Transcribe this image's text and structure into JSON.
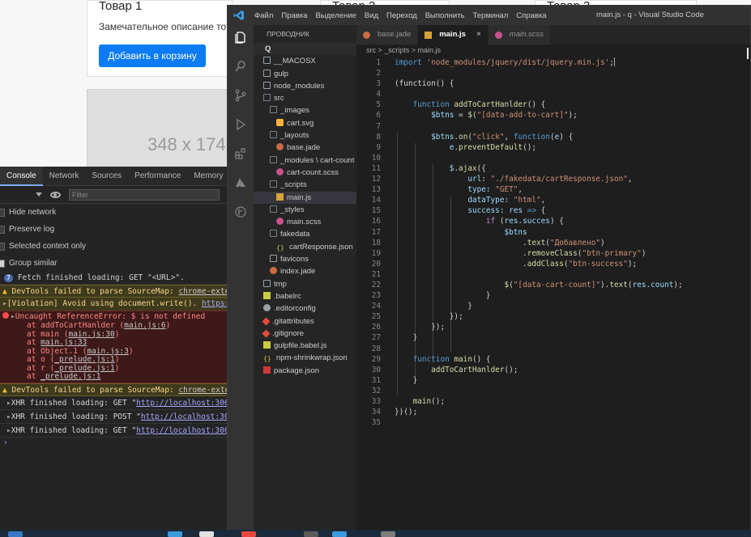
{
  "web": {
    "cards": [
      {
        "title": "Товар 1",
        "desc": "Замечательное описание тов",
        "button": "Добавить в корзину"
      },
      {
        "title": "Товар 2"
      },
      {
        "title": "Товар 3"
      }
    ],
    "placeholder_image": "348 x 174"
  },
  "devtools": {
    "tabs": [
      "Console",
      "Network",
      "Sources",
      "Performance",
      "Memory"
    ],
    "active_tab": "Console",
    "filter_placeholder": "Filter",
    "options": [
      {
        "label": "Hide network",
        "checked": false
      },
      {
        "label": "Preserve log",
        "checked": false
      },
      {
        "label": "Selected context only",
        "checked": false
      },
      {
        "label": "Group similar",
        "checked": true
      }
    ],
    "log": {
      "fetch_count": "7",
      "fetch_text": "Fetch finished loading: GET \"<URL>\".",
      "warn1_text": "DevTools failed to parse SourceMap: ",
      "warn1_link": "chrome-extension",
      "violation_text": "[Violation] Avoid using document.write(). ",
      "violation_link": "https:/",
      "error_title": "Uncaught ReferenceError: $ is not defined",
      "frames": [
        {
          "pre": "at addToCartHanlder (",
          "link": "main.js:6",
          "post": ")"
        },
        {
          "pre": "at main (",
          "link": "main.js:30",
          "post": ")"
        },
        {
          "pre": "at ",
          "link": "main.js:33",
          "post": ""
        },
        {
          "pre": "at Object.1 (",
          "link": "main.js:3",
          "post": ")"
        },
        {
          "pre": "at o (",
          "link": "_prelude.js:1",
          "post": ")"
        },
        {
          "pre": "at r (",
          "link": "_prelude.js:1",
          "post": ")"
        },
        {
          "pre": "at ",
          "link": "_prelude.js:1",
          "post": ""
        }
      ],
      "warn2_text": "DevTools failed to parse SourceMap: ",
      "warn2_link": "chrome-extension",
      "xhr": [
        {
          "pre": "XHR finished loading: GET \"",
          "link": "http://localhost:3000/l"
        },
        {
          "pre": "XHR finished loading: POST \"",
          "link": "http://localhost:3000/"
        },
        {
          "pre": "XHR finished loading: GET \"",
          "link": "http://localhost:3000/l"
        }
      ]
    }
  },
  "vscode": {
    "menu": [
      "Файл",
      "Правка",
      "Выделение",
      "Вид",
      "Переход",
      "Выполнить",
      "Терминал",
      "Справка"
    ],
    "window_title": "main.js - q - Visual Studio Code",
    "explorer_title": "ПРОВОДНИК",
    "tree": [
      {
        "label": "Q",
        "depth": 0,
        "icon": "root"
      },
      {
        "label": "__MACOSX",
        "depth": 1,
        "icon": "folder"
      },
      {
        "label": "gulp",
        "depth": 1,
        "icon": "folder-gulp"
      },
      {
        "label": "node_modules",
        "depth": 1,
        "icon": "folder-node"
      },
      {
        "label": "src",
        "depth": 1,
        "icon": "folder-open"
      },
      {
        "label": "_images",
        "depth": 2,
        "icon": "folder-open"
      },
      {
        "label": "cart.svg",
        "depth": 3,
        "icon": "svg"
      },
      {
        "label": "_layouts",
        "depth": 2,
        "icon": "folder-open"
      },
      {
        "label": "base.jade",
        "depth": 3,
        "icon": "jade"
      },
      {
        "label": "_modules \\ cart-count",
        "depth": 2,
        "icon": "folder-open"
      },
      {
        "label": "cart-count.scss",
        "depth": 3,
        "icon": "scss"
      },
      {
        "label": "_scripts",
        "depth": 2,
        "icon": "folder-open"
      },
      {
        "label": "main.js",
        "depth": 3,
        "icon": "js",
        "selected": true
      },
      {
        "label": "_styles",
        "depth": 2,
        "icon": "folder-open"
      },
      {
        "label": "main.scss",
        "depth": 3,
        "icon": "scss"
      },
      {
        "label": "fakedata",
        "depth": 2,
        "icon": "folder-open"
      },
      {
        "label": "cartResponse.json",
        "depth": 3,
        "icon": "json"
      },
      {
        "label": "favicons",
        "depth": 2,
        "icon": "folder"
      },
      {
        "label": "index.jade",
        "depth": 2,
        "icon": "jade"
      },
      {
        "label": "tmp",
        "depth": 1,
        "icon": "folder"
      },
      {
        "label": ".babelrc",
        "depth": 1,
        "icon": "babel"
      },
      {
        "label": ".editorconfig",
        "depth": 1,
        "icon": "cfg"
      },
      {
        "label": ".gitattributes",
        "depth": 1,
        "icon": "git"
      },
      {
        "label": ".gitignore",
        "depth": 1,
        "icon": "git"
      },
      {
        "label": "gulpfile.babel.js",
        "depth": 1,
        "icon": "babel"
      },
      {
        "label": "npm-shrinkwrap.json",
        "depth": 1,
        "icon": "json"
      },
      {
        "label": "package.json",
        "depth": 1,
        "icon": "pkg"
      }
    ],
    "tabs": [
      {
        "label": "base.jade",
        "icon": "jade",
        "active": false,
        "italic": false
      },
      {
        "label": "main.js",
        "icon": "js",
        "active": true,
        "italic": false,
        "close": "×"
      },
      {
        "label": "main.scss",
        "icon": "scss",
        "active": false,
        "italic": true
      }
    ],
    "breadcrumb": "src > _scripts > main.js",
    "code": [
      [
        [
          "k",
          "import "
        ],
        [
          "s",
          "'node_modules/jquery/dist/jquery.min.js'"
        ],
        [
          "p",
          ";"
        ]
      ],
      [],
      [
        [
          "p",
          "(function() {"
        ]
      ],
      [],
      [
        [
          "p",
          "    "
        ],
        [
          "k",
          "function "
        ],
        [
          "f",
          "addToCartHanlder"
        ],
        [
          "p",
          "() {"
        ]
      ],
      [
        [
          "p",
          "        "
        ],
        [
          "v",
          "$btns"
        ],
        [
          "p",
          " = "
        ],
        [
          "f",
          "$"
        ],
        [
          "p",
          "("
        ],
        [
          "s",
          "\"[data-add-to-cart]\""
        ],
        [
          "p",
          ");"
        ]
      ],
      [],
      [
        [
          "p",
          "        "
        ],
        [
          "v",
          "$btns"
        ],
        [
          "p",
          "."
        ],
        [
          "f",
          "on"
        ],
        [
          "p",
          "("
        ],
        [
          "s",
          "\"click\""
        ],
        [
          "p",
          ", "
        ],
        [
          "k",
          "function"
        ],
        [
          "p",
          "("
        ],
        [
          "v",
          "e"
        ],
        [
          "p",
          ") {"
        ]
      ],
      [
        [
          "p",
          "            "
        ],
        [
          "v",
          "e"
        ],
        [
          "p",
          "."
        ],
        [
          "f",
          "preventDefault"
        ],
        [
          "p",
          "();"
        ]
      ],
      [],
      [
        [
          "p",
          "            "
        ],
        [
          "v",
          "$"
        ],
        [
          "p",
          "."
        ],
        [
          "f",
          "ajax"
        ],
        [
          "p",
          "({"
        ]
      ],
      [
        [
          "p",
          "                "
        ],
        [
          "v",
          "url"
        ],
        [
          "p",
          ": "
        ],
        [
          "s",
          "\"./fakedata/cartResponse.json\""
        ],
        [
          "p",
          ","
        ]
      ],
      [
        [
          "p",
          "                "
        ],
        [
          "v",
          "type"
        ],
        [
          "p",
          ": "
        ],
        [
          "s",
          "\"GET\""
        ],
        [
          "p",
          ","
        ]
      ],
      [
        [
          "p",
          "                "
        ],
        [
          "v",
          "dataType"
        ],
        [
          "p",
          ": "
        ],
        [
          "s",
          "\"html\""
        ],
        [
          "p",
          ","
        ]
      ],
      [
        [
          "p",
          "                "
        ],
        [
          "v",
          "success"
        ],
        [
          "p",
          ": "
        ],
        [
          "v",
          "res"
        ],
        [
          "p",
          " "
        ],
        [
          "k",
          "=>"
        ],
        [
          "p",
          " {"
        ]
      ],
      [
        [
          "p",
          "                    "
        ],
        [
          "kc",
          "if"
        ],
        [
          "p",
          " ("
        ],
        [
          "v",
          "res"
        ],
        [
          "p",
          "."
        ],
        [
          "v",
          "succes"
        ],
        [
          "p",
          ") {"
        ]
      ],
      [
        [
          "p",
          "                        "
        ],
        [
          "v",
          "$btns"
        ]
      ],
      [
        [
          "p",
          "                            ."
        ],
        [
          "f",
          "text"
        ],
        [
          "p",
          "("
        ],
        [
          "s",
          "\"Добавлено\""
        ],
        [
          "p",
          ")"
        ]
      ],
      [
        [
          "p",
          "                            ."
        ],
        [
          "f",
          "removeClass"
        ],
        [
          "p",
          "("
        ],
        [
          "s",
          "\"btn-primary\""
        ],
        [
          "p",
          ")"
        ]
      ],
      [
        [
          "p",
          "                            ."
        ],
        [
          "f",
          "addClass"
        ],
        [
          "p",
          "("
        ],
        [
          "s",
          "\"btn-success\""
        ],
        [
          "p",
          ");"
        ]
      ],
      [],
      [
        [
          "p",
          "                        "
        ],
        [
          "f",
          "$"
        ],
        [
          "p",
          "("
        ],
        [
          "s",
          "\"[data-cart-count]\""
        ],
        [
          "p",
          ")."
        ],
        [
          "f",
          "text"
        ],
        [
          "p",
          "("
        ],
        [
          "v",
          "res"
        ],
        [
          "p",
          "."
        ],
        [
          "v",
          "count"
        ],
        [
          "p",
          ");"
        ]
      ],
      [
        [
          "p",
          "                    }"
        ]
      ],
      [
        [
          "p",
          "                }"
        ]
      ],
      [
        [
          "p",
          "            });"
        ]
      ],
      [
        [
          "p",
          "        });"
        ]
      ],
      [
        [
          "p",
          "    }"
        ]
      ],
      [],
      [
        [
          "p",
          "    "
        ],
        [
          "k",
          "function "
        ],
        [
          "f",
          "main"
        ],
        [
          "p",
          "() {"
        ]
      ],
      [
        [
          "p",
          "        "
        ],
        [
          "f",
          "addToCartHanlder"
        ],
        [
          "p",
          "();"
        ]
      ],
      [
        [
          "p",
          "    }"
        ]
      ],
      [],
      [
        [
          "p",
          "    "
        ],
        [
          "f",
          "main"
        ],
        [
          "p",
          "();"
        ]
      ],
      [
        [
          "p",
          "})();"
        ]
      ],
      []
    ]
  },
  "colors": {
    "editor_bg": "#1e1e1e",
    "sidebar_bg": "#252526",
    "activity_bg": "#333333",
    "vscode_blue": "#3c9adf",
    "devtools_bg": "#242424",
    "error_bg": "#3d1919",
    "warning_bg": "#3f3a1c",
    "primary_button": "#0d7cf2"
  }
}
